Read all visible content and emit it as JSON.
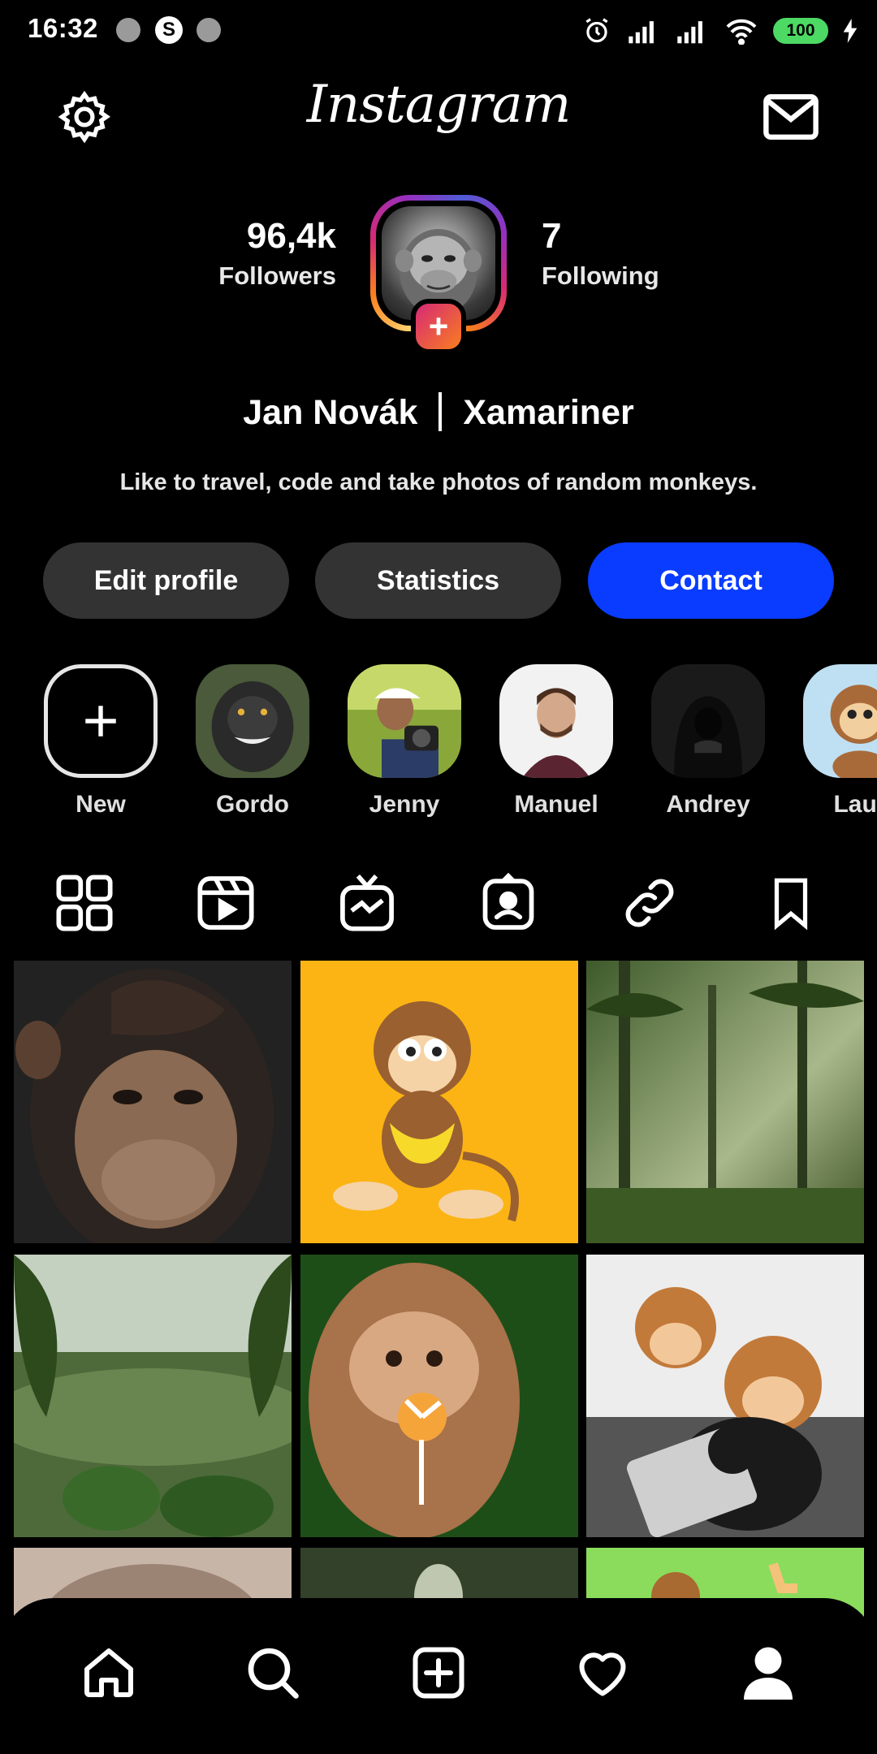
{
  "status_bar": {
    "time": "16:32",
    "notif_letter": "S",
    "battery": "100"
  },
  "header": {
    "logo": "Instagram"
  },
  "profile": {
    "followers_count": "96,4k",
    "followers_label": "Followers",
    "following_count": "7",
    "following_label": "Following",
    "name": "Jan Novák",
    "role": "Xamariner",
    "bio": "Like to travel, code and take photos of random monkeys."
  },
  "actions": {
    "edit": "Edit profile",
    "stats": "Statistics",
    "contact": "Contact"
  },
  "highlights": [
    {
      "label": "New"
    },
    {
      "label": "Gordo"
    },
    {
      "label": "Jenny"
    },
    {
      "label": "Manuel"
    },
    {
      "label": "Andrey"
    },
    {
      "label": "Laur"
    }
  ],
  "tabs": [
    "grid-icon",
    "reels-icon",
    "igtv-icon",
    "tagged-icon",
    "link-icon",
    "bookmark-icon"
  ],
  "bottom_nav": [
    "home-icon",
    "search-icon",
    "add-post-icon",
    "heart-icon",
    "profile-icon"
  ],
  "colors": {
    "contact_button": "#0a3cff",
    "secondary_button": "#333333",
    "battery": "#4cd964"
  }
}
